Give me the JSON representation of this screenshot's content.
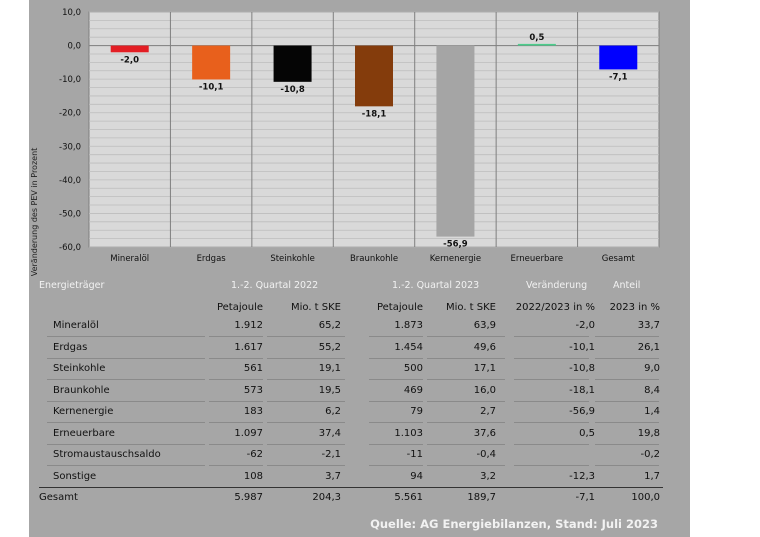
{
  "chart_data": {
    "type": "bar",
    "ylabel": "Veränderung des PEV in Prozent",
    "ylim": [
      -60,
      10
    ],
    "y_ticks": [
      "10,0",
      "0,0",
      "-10,0",
      "-20,0",
      "-30,0",
      "-40,0",
      "-50,0",
      "-60,0"
    ],
    "y_tick_values": [
      10,
      0,
      -10,
      -20,
      -30,
      -40,
      -50,
      -60
    ],
    "grid": true,
    "categories": [
      "Mineralöl",
      "Erdgas",
      "Steinkohle",
      "Braunkohle",
      "Kernenergie",
      "Erneuerbare",
      "Gesamt"
    ],
    "values": [
      -2.0,
      -10.1,
      -10.8,
      -18.1,
      -56.9,
      0.5,
      -7.1
    ],
    "value_labels": [
      "-2,0",
      "-10,1",
      "-10,8",
      "-18,1",
      "-56,9",
      "0,5",
      "-7,1"
    ],
    "colors": [
      "#e31e24",
      "#e8601c",
      "#050505",
      "#843c0c",
      "#a5a5a5",
      "#4ccc8c",
      "#0000ff"
    ]
  },
  "table": {
    "header": {
      "col0": "Energieträger",
      "group1": "1.-2. Quartal 2022",
      "group2": "1.-2. Quartal 2023",
      "group3": "Veränderung",
      "group4": "Anteil"
    },
    "subheader": {
      "c1": "Petajoule",
      "c2": "Mio. t SKE",
      "c3": "Petajoule",
      "c4": "Mio. t SKE",
      "c5": "2022/2023 in %",
      "c6": "2023 in %"
    },
    "rows": [
      {
        "name": "Mineralöl",
        "c1": "1.912",
        "c2": "65,2",
        "c3": "1.873",
        "c4": "63,9",
        "c5": "-2,0",
        "c6": "33,7"
      },
      {
        "name": "Erdgas",
        "c1": "1.617",
        "c2": "55,2",
        "c3": "1.454",
        "c4": "49,6",
        "c5": "-10,1",
        "c6": "26,1"
      },
      {
        "name": "Steinkohle",
        "c1": "561",
        "c2": "19,1",
        "c3": "500",
        "c4": "17,1",
        "c5": "-10,8",
        "c6": "9,0"
      },
      {
        "name": "Braunkohle",
        "c1": "573",
        "c2": "19,5",
        "c3": "469",
        "c4": "16,0",
        "c5": "-18,1",
        "c6": "8,4"
      },
      {
        "name": "Kernenergie",
        "c1": "183",
        "c2": "6,2",
        "c3": "79",
        "c4": "2,7",
        "c5": "-56,9",
        "c6": "1,4"
      },
      {
        "name": "Erneuerbare",
        "c1": "1.097",
        "c2": "37,4",
        "c3": "1.103",
        "c4": "37,6",
        "c5": "0,5",
        "c6": "19,8"
      },
      {
        "name": "Stromaustauschsaldo",
        "c1": "-62",
        "c2": "-2,1",
        "c3": "-11",
        "c4": "-0,4",
        "c5": "",
        "c6": "-0,2"
      },
      {
        "name": "Sonstige",
        "c1": "108",
        "c2": "3,7",
        "c3": "94",
        "c4": "3,2",
        "c5": "-12,3",
        "c6": "1,7"
      }
    ],
    "total": {
      "name": "Gesamt",
      "c1": "5.987",
      "c2": "204,3",
      "c3": "5.561",
      "c4": "189,7",
      "c5": "-7,1",
      "c6": "100,0"
    }
  },
  "source": "Quelle: AG Energiebilanzen, Stand: Juli 2023"
}
